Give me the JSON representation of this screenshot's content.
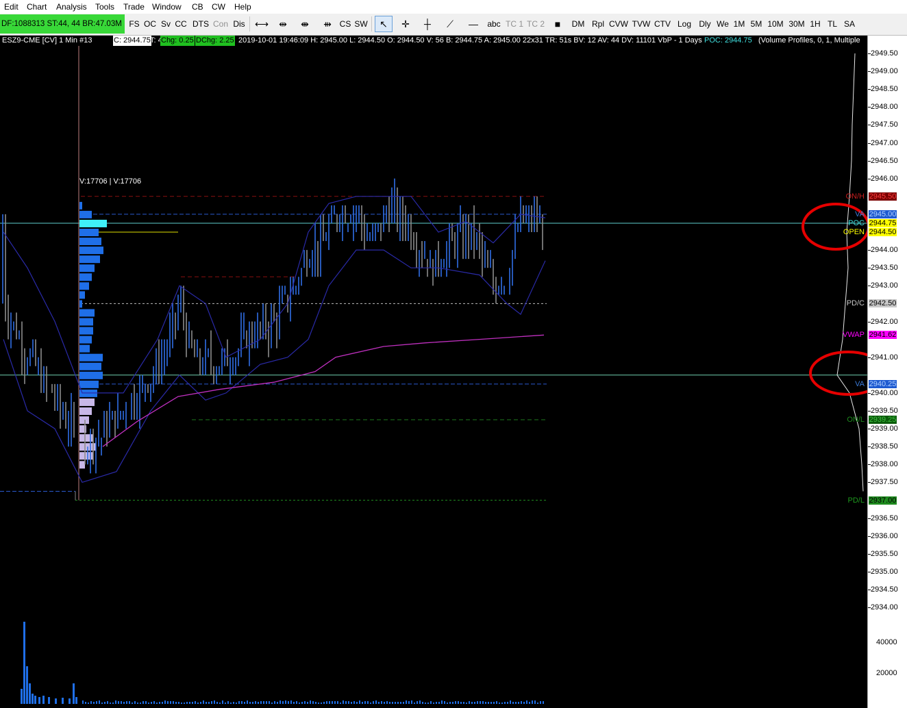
{
  "menu": [
    "Edit",
    "Chart",
    "Analysis",
    "Tools",
    "Trade",
    "Window",
    "CB",
    "CW",
    "Help"
  ],
  "toolbar": {
    "df_text": "DF:1088313  ST:44, 44  BR:47.03M",
    "buttons": [
      "FS",
      "OC",
      "Sv",
      "CC",
      "DTS",
      "Con",
      "Dis",
      "CS",
      "SW",
      "abc",
      "TC 1",
      "TC 2",
      "DM",
      "Rpl",
      "CVW",
      "TVW",
      "CTV",
      "Log",
      "Dly",
      "We",
      "1M",
      "5M",
      "10M",
      "30M",
      "1H",
      "TL",
      "SA"
    ]
  },
  "infobar": {
    "symbol": "ESZ9-CME [CV]  1 Min  #13",
    "close": "C: 2944.75",
    "ticks": "T: 40",
    "chg": "Chg: 0.25",
    "dchg": "DChg: 2.25",
    "details": "2019-10-01 19:46:09 H: 2945.00 L: 2944.50 O: 2944.50 V: 56 B: 2944.75 A: 2945.00 22x31  TR: 51s BV: 12 AV: 44 DV: 11101 VbP - 1 Days",
    "poc": "POC: 2944.75",
    "study": "(Volume Profiles, 0, 1, Multiple"
  },
  "profile_label": "V:17706 | V:17706",
  "axis": {
    "price_ticks": [
      "2949.50",
      "2949.00",
      "2948.50",
      "2948.00",
      "2947.50",
      "2947.00",
      "2946.50",
      "2946.00",
      "2944.00",
      "2943.50",
      "2943.00",
      "2942.00",
      "2941.00",
      "2940.00",
      "2939.50",
      "2939.00",
      "2938.50",
      "2938.00",
      "2937.50",
      "2936.50",
      "2936.00",
      "2935.50",
      "2935.00",
      "2934.50",
      "2934.00"
    ],
    "volume_ticks": [
      "40000",
      "20000"
    ]
  },
  "levels": [
    {
      "label": "ON/H",
      "price": "2945.50",
      "label_color": "#c81e1e",
      "tag_bg": "#7a0000",
      "tag_fg": "#ff4040"
    },
    {
      "label": "VA",
      "price": "2945.00",
      "label_color": "#3a7ad8",
      "tag_bg": "#1e5ad0",
      "tag_fg": "#b0d0ff"
    },
    {
      "label": "POC",
      "price": "2944.75",
      "label_color": "#40e0e0",
      "tag_bg": "#ffff00",
      "tag_fg": "#000000"
    },
    {
      "label": "OPEN",
      "price": "2944.50",
      "label_color": "#ffff00",
      "tag_bg": "#ffff00",
      "tag_fg": "#000000"
    },
    {
      "label": "PD/C",
      "price": "2942.50",
      "label_color": "#c8c8c8",
      "tag_bg": "#c8c8c8",
      "tag_fg": "#000000"
    },
    {
      "label": "VWAP",
      "price": "2941.62",
      "label_color": "#ff00ff",
      "tag_bg": "#ff00ff",
      "tag_fg": "#000000"
    },
    {
      "label": "VA",
      "price": "2940.25",
      "label_color": "#3a7ad8",
      "tag_bg": "#1e5ad0",
      "tag_fg": "#b0d0ff"
    },
    {
      "label": "ON/L",
      "price": "2939.25",
      "label_color": "#1e8a1e",
      "tag_bg": "#0a5a0a",
      "tag_fg": "#40c040"
    },
    {
      "label": "PD/L",
      "price": "2937.00",
      "label_color": "#1e9a1e",
      "tag_bg": "#1e8a1e",
      "tag_fg": "#000000"
    }
  ],
  "colors": {
    "annotation": "#e60000",
    "bar_up": "#2f6fe6",
    "bar_down": "#8c8c8c",
    "bands": "#2a2aa8",
    "vwap": "#c030c0",
    "profile": "#1f6fe8",
    "poc_bar": "#40f0f8"
  }
}
